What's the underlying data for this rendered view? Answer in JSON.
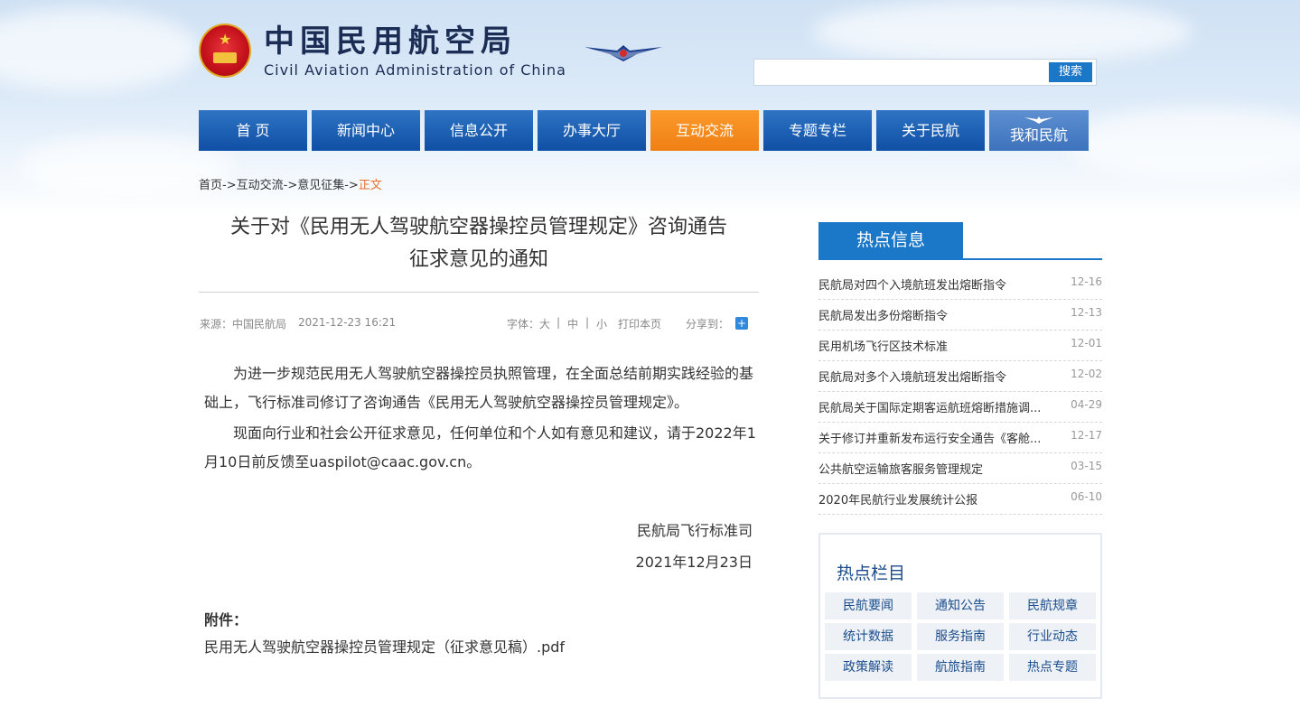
{
  "header": {
    "logo_cn": "中国民用航空局",
    "logo_en": "Civil Aviation Administration of China",
    "search": {
      "placeholder": "",
      "button": "搜索"
    }
  },
  "nav": {
    "items": [
      "首 页",
      "新闻中心",
      "信息公开",
      "办事大厅",
      "互动交流",
      "专题专栏",
      "关于民航",
      "我和民航"
    ],
    "active": "互动交流"
  },
  "breadcrumb": {
    "home": "首页",
    "sep": "->",
    "l1": "互动交流",
    "l2": "意见征集",
    "current": "正文"
  },
  "article": {
    "title_line1": "关于对《民用无人驾驶航空器操控员管理规定》咨询通告",
    "title_line2": "征求意见的通知",
    "source": "来源：中国民航局",
    "date": "2021-12-23 16:21",
    "font_label": "字体：",
    "font_large": "大",
    "font_mid": "中",
    "font_small": "小",
    "divider": "|",
    "print": "打印本页",
    "share": "分享到：",
    "share_icon": "+",
    "para1": "为进一步规范民用无人驾驶航空器操控员执照管理，在全面总结前期实践经验的基础上，飞行标准司修订了咨询通告《民用无人驾驶航空器操控员管理规定》。",
    "para2": "现面向行业和社会公开征求意见，任何单位和个人如有意见和建议，请于2022年1月10日前反馈至uaspilot@caac.gov.cn。",
    "sign_dept": "民航局飞行标准司",
    "sign_date": "2021年12月23日",
    "attach_head": "附件：",
    "attach_file": "民用无人驾驶航空器操控员管理规定（征求意见稿）.pdf"
  },
  "hot_info": {
    "title": "热点信息",
    "items": [
      {
        "t": "民航局对四个入境航班发出熔断指令",
        "d": "12-16"
      },
      {
        "t": "民航局发出多份熔断指令",
        "d": "12-13"
      },
      {
        "t": "民用机场飞行区技术标准",
        "d": "12-01"
      },
      {
        "t": "民航局对多个入境航班发出熔断指令",
        "d": "12-02"
      },
      {
        "t": "民航局关于国际定期客运航班熔断措施调...",
        "d": "04-29"
      },
      {
        "t": "关于修订并重新发布运行安全通告《客舱...",
        "d": "12-17"
      },
      {
        "t": "公共航空运输旅客服务管理规定",
        "d": "03-15"
      },
      {
        "t": "2020年民航行业发展统计公报",
        "d": "06-10"
      }
    ]
  },
  "hot_columns": {
    "title": "热点栏目",
    "items": [
      "民航要闻",
      "通知公告",
      "民航规章",
      "统计数据",
      "服务指南",
      "行业动态",
      "政策解读",
      "航旅指南",
      "热点专题"
    ]
  },
  "colors": {
    "nav_blue": "#0f4fa5",
    "nav_active": "#f07f14",
    "accent_orange": "#e4722a",
    "link_blue": "#1b77c8"
  }
}
